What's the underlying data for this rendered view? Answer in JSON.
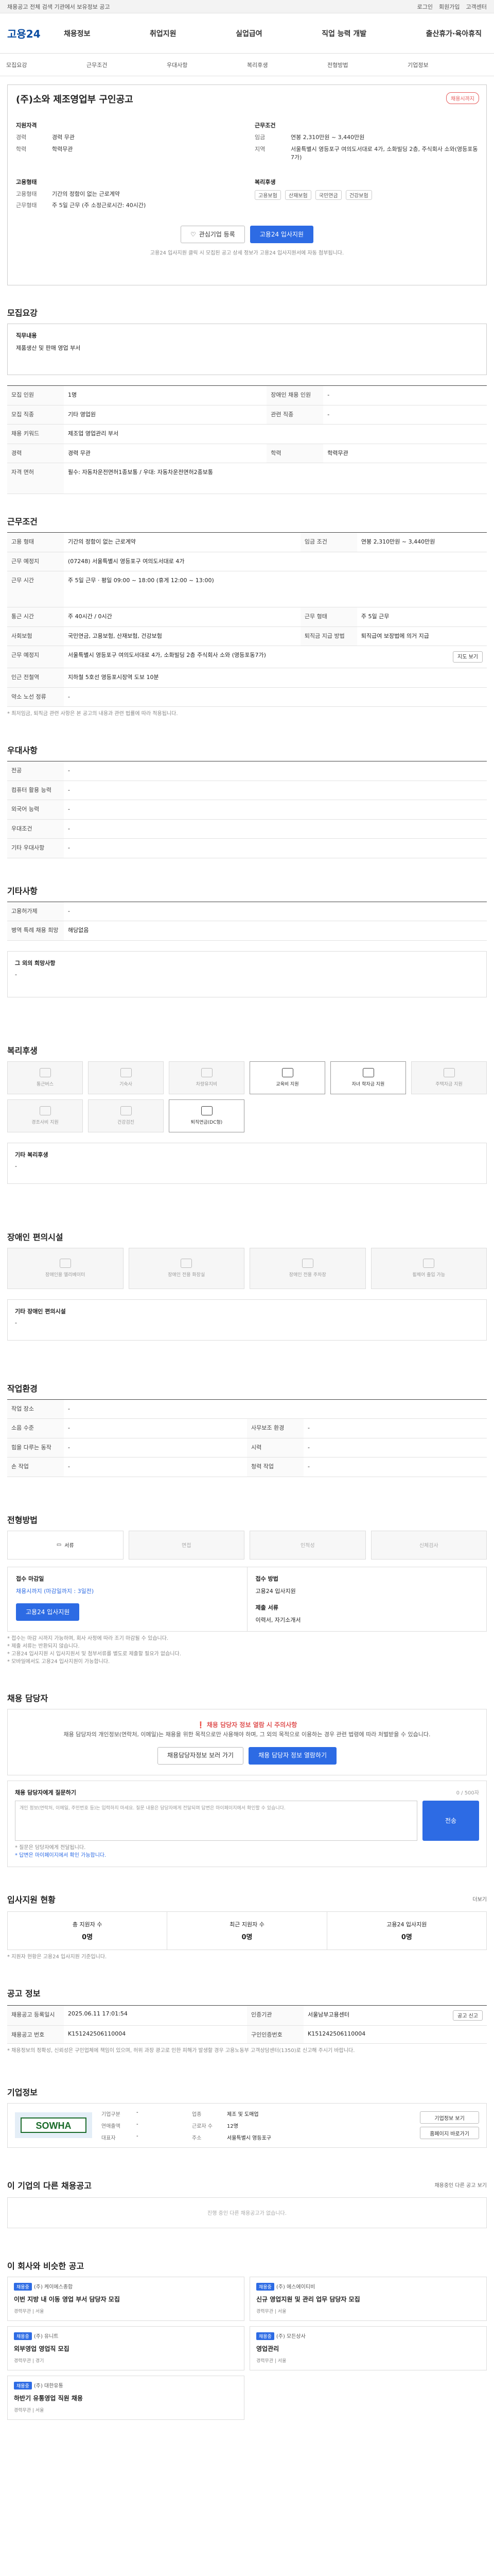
{
  "topbar": {
    "left": "채용공고 전체 검색 기관에서 보유정보 공고",
    "links": [
      "로그인",
      "회원가입",
      "고객센터"
    ]
  },
  "logo": "고용24",
  "gnb": [
    "채용정보",
    "취업지원",
    "실업급여",
    "직업 능력 개발",
    "출산휴가·육아휴직"
  ],
  "subtabs": [
    "모집요강",
    "근무조건",
    "우대사항",
    "복리후생",
    "전형방법",
    "기업정보"
  ],
  "job": {
    "title": "(주)소와 제조영업부 구인공고",
    "status_badge": "채용시까지",
    "left_label": "지원자격",
    "left": [
      {
        "k": "경력",
        "v": "경력 무관"
      },
      {
        "k": "학력",
        "v": "학력무관"
      }
    ],
    "right_label": "근무조건",
    "right": [
      {
        "k": "임금",
        "v": "연봉 2,310만원 ~ 3,440만원"
      },
      {
        "k": "지역",
        "v": "서울특별시 영등포구 여의도서대로 4가, 소화빌딩 2층, 주식회사 소와(영등포동7가)"
      }
    ],
    "type_label": "고용형태",
    "type": [
      {
        "k": "고용형태",
        "v": "기간의 정함이 없는 근로계약"
      },
      {
        "k": "근무형태",
        "v": "주 5일 근무 (주 소정근로시간: 40시간)"
      }
    ],
    "welfare_label": "복리후생",
    "welfare_tags": [
      "고용보험",
      "산재보험",
      "국민연금",
      "건강보험"
    ],
    "save_button": "관심기업 등록",
    "apply_button": "고용24 입사지원",
    "note": "고용24 입사지원 클릭 시 모집된 공고 상세 정보가 고용24 입사지원서에 자동 첨부됩니다."
  },
  "recruit": {
    "title": "모집요강",
    "job_desc_label": "직무내용",
    "job_desc": "제품생산 및 판매 영업 부서",
    "rows": [
      {
        "k": "모집 인원",
        "v": "1명",
        "k2": "장애인 채용 인원",
        "v2": "-"
      },
      {
        "k": "모집 직종",
        "v": "기타 영업원",
        "k2": "관련 직종",
        "v2": "-"
      },
      {
        "k": "채용 키워드",
        "v": "제조업 영업관리 부서",
        "k2": "",
        "v2": ""
      },
      {
        "k": "경력",
        "v": "경력 무관",
        "k2": "학력",
        "v2": "학력무관"
      },
      {
        "k": "자격 면허",
        "v": "필수: 자동차운전면허1종보통 / 우대: 자동차운전면허2종보통",
        "k2": "",
        "v2": ""
      }
    ]
  },
  "work": {
    "title": "근무조건",
    "rows": [
      {
        "k": "고용 형태",
        "v": "기간의 정함이 없는 근로계약",
        "k2": "임금 조건",
        "v2": "연봉 2,310만원 ~ 3,440만원"
      },
      {
        "k": "근무 예정지",
        "v": "(07248) 서울특별시 영등포구 여의도서대로 4가",
        "k2": "",
        "v2": ""
      },
      {
        "k": "근무 시간",
        "v": "주 5일 근무 · 평일 09:00 ~ 18:00 (휴게 12:00 ~ 13:00)",
        "k2": "",
        "v2": ""
      },
      {
        "k": "통근 시간",
        "v": "주 40시간 / 0시간",
        "k2": "근무 형태",
        "v2": "주 5일 근무"
      },
      {
        "k": "사회보험",
        "v": "국민연금, 고용보험, 산재보험, 건강보험",
        "k2": "퇴직금 지급 방법",
        "v2": "퇴직급여 보장법에 의거 지급"
      },
      {
        "k": "근무 예정지",
        "v": "서울특별시 영등포구 여의도서대로 4가, 소화빌딩 2층 주식회사 소와 (영등포동7가)",
        "k2": "",
        "v2": ""
      },
      {
        "k": "인근 전철역",
        "v": "지하철 5호선 영등포시장역 도보 10분",
        "k2": "",
        "v2": ""
      },
      {
        "k": "약소 노선 정류",
        "v": "-",
        "k2": "",
        "v2": ""
      }
    ],
    "note": "* 최저임금, 퇴직금 관련 사항은 본 공고의 내용과 관련 법률에 따라 적용됩니다.",
    "map_button": "지도 보기"
  },
  "pref": {
    "title": "우대사항",
    "rows": [
      {
        "k": "전공",
        "v": "-"
      },
      {
        "k": "컴퓨터 활용 능력",
        "v": "-"
      },
      {
        "k": "외국어 능력",
        "v": "-"
      },
      {
        "k": "우대조건",
        "v": "-"
      },
      {
        "k": "기타 우대사항",
        "v": "-"
      }
    ]
  },
  "extra": {
    "title": "기타사항",
    "rows": [
      {
        "k": "고용허가제",
        "v": "-"
      },
      {
        "k": "병역 특례 채용 희망",
        "v": "해당없음"
      }
    ],
    "note_label": "그 외의 희망사항",
    "note": "-"
  },
  "welfare": {
    "title": "복리후생",
    "items": [
      {
        "label": "통근버스",
        "on": false
      },
      {
        "label": "기숙사",
        "on": false
      },
      {
        "label": "차량유지비",
        "on": false
      },
      {
        "label": "교육비 지원",
        "on": true
      },
      {
        "label": "자녀 학자금 지원",
        "on": true
      },
      {
        "label": "주택자금 지원",
        "on": false
      },
      {
        "label": "경조사비 지원",
        "on": false
      },
      {
        "label": "건강검진",
        "on": false
      },
      {
        "label": "퇴직연금(DC형)",
        "on": true
      }
    ],
    "other_label": "기타 복리후생",
    "other": "-"
  },
  "disability": {
    "title": "장애인 편의시설",
    "items": [
      "장애인용 엘리베이터",
      "장애인 전용 화장실",
      "장애인 전용 주차장",
      "휠체어 출입 가능"
    ],
    "other_label": "기타 장애인 편의시설",
    "other": "-"
  },
  "workenv": {
    "title": "작업환경",
    "rows": [
      {
        "k": "작업 장소",
        "v": "-",
        "k2": "",
        "v2": ""
      },
      {
        "k": "소음 수준",
        "v": "-",
        "k2": "사무보조 환경",
        "v2": "-"
      },
      {
        "k": "힘을 다루는 동작",
        "v": "-",
        "k2": "시력",
        "v2": "-"
      },
      {
        "k": "손 작업",
        "v": "-",
        "k2": "청력 작업",
        "v2": "-"
      }
    ]
  },
  "process": {
    "title": "전형방법",
    "steps": [
      {
        "label": "서류",
        "on": true
      },
      {
        "label": "면접",
        "on": false
      },
      {
        "label": "인적성",
        "on": false
      },
      {
        "label": "신체검사",
        "on": false
      }
    ],
    "deadline_label": "접수 마감일",
    "deadline": "채용시까지 (마감일까지 : 3일전)",
    "method_label": "접수 방법",
    "method": "고용24 입사지원",
    "apply_button": "고용24 입사지원",
    "docs_label": "제출 서류",
    "docs": "이력서, 자기소개서",
    "notes": [
      "* 접수는 마감 시까지 가능하며, 회사 사정에 따라 조기 마감될 수 있습니다.",
      "* 제출 서류는 반환되지 않습니다.",
      "* 고용24 입사지원 시 입사지원서 및 첨부서류를 별도로 제출할 필요가 없습니다.",
      "* 모바일에서도 고용24 입사지원이 가능합니다."
    ]
  },
  "contact": {
    "title": "채용 담당자",
    "warn_title": "채용 담당자 정보 열람 시 주의사항",
    "warn_text": "채용 담당자의 개인정보(연락처, 이메일)는 채용을 위한 목적으로만 사용해야 하며, 그 외의 목적으로 이용하는 경우 관련 법령에 따라 처벌받을 수 있습니다.",
    "btn_view": "채용담당자정보 보러 가기",
    "btn_agree": "채용 담당자 정보 열람하기",
    "q_title": "채용 담당자에게 질문하기",
    "q_count": "0 / 500자",
    "q_placeholder": "개인 정보(연락처, 이메일, 주민번호 등)는 입력하지 마세요. 질문 내용은 담당자에게 전달되며 답변은 마이페이지에서 확인할 수 있습니다.",
    "q_button": "전송",
    "q_notes": [
      "* 질문은 담당자에게 전달됩니다.",
      "* 답변은 마이페이지에서 확인 가능합니다."
    ]
  },
  "stats": {
    "title": "입사지원 현황",
    "more": "더보기",
    "items": [
      {
        "label": "총 지원자 수",
        "value": "0명"
      },
      {
        "label": "최근 지원자 수",
        "value": "0명"
      },
      {
        "label": "고용24 입사지원",
        "value": "0명"
      }
    ],
    "note": "* 지원자 현황은 고용24 입사지원 기준입니다."
  },
  "meta": {
    "title": "공고 정보",
    "rows": [
      {
        "k": "채용공고 등록일시",
        "v": "2025.06.11 17:01:54",
        "k2": "인증기관",
        "v2": "서울남부고용센터"
      },
      {
        "k": "채용공고 번호",
        "v": "K151242506110004",
        "k2": "구인인증번호",
        "v2": "K151242506110004"
      }
    ],
    "btn": "공고 신고",
    "note": "* 채용정보의 정확성, 신뢰성은 구인업체에 책임이 있으며, 허위 과장 광고로 인한 피해가 발생할 경우 고용노동부 고객상담센터(1350)로 신고해 주시기 바랍니다."
  },
  "company": {
    "title": "기업정보",
    "logo_text": "SOWHA",
    "fields": [
      {
        "k": "기업구분",
        "v": "-"
      },
      {
        "k": "업종",
        "v": "제조 및 도매업"
      },
      {
        "k": "연매출액",
        "v": "-"
      },
      {
        "k": "근로자 수",
        "v": "12명"
      },
      {
        "k": "대표자",
        "v": "-"
      },
      {
        "k": "주소",
        "v": "서울특별시 영등포구"
      }
    ],
    "btn_info": "기업정보 보기",
    "btn_more": "홈페이지 바로가기"
  },
  "others": {
    "title": "이 기업의 다른 채용공고",
    "more": "채용중인 다른 공고 보기",
    "empty": "진행 중인 다른 채용공고가 없습니다."
  },
  "recommend": {
    "title": "이 회사와 비슷한 공고",
    "cards": [
      {
        "tag": "채용중",
        "company": "(주) 케이에스종합",
        "title": "이번 지방 내 이동 영업 부서 담당자 모집",
        "foot": "경력무관 | 서울"
      },
      {
        "tag": "채용중",
        "company": "(주) 에스에이티비",
        "title": "신규 영업지원 및 관리 업무 담당자 모집",
        "foot": "경력무관 | 서울"
      },
      {
        "tag": "채용중",
        "company": "(주) 유니트",
        "title": "외부영업 영업직 모집",
        "foot": "경력무관 | 경기"
      },
      {
        "tag": "채용중",
        "company": "(주) 모든상사",
        "title": "영업관리",
        "foot": "경력무관 | 서울"
      },
      {
        "tag": "채용중",
        "company": "(주) 대한유통",
        "title": "하반기 유통영업 직원 채용",
        "foot": "경력무관 | 서울"
      }
    ]
  }
}
